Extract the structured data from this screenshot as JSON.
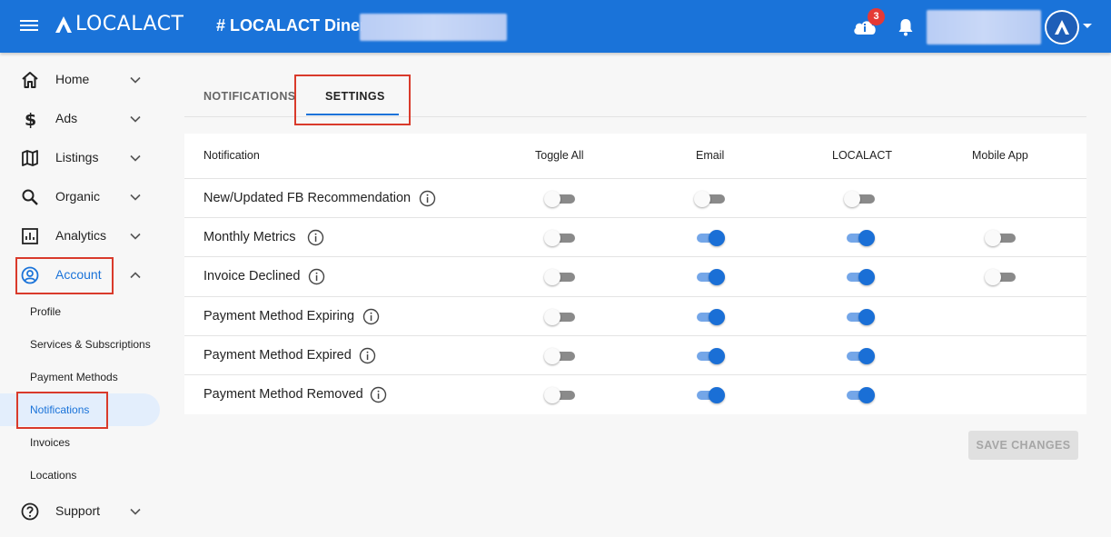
{
  "header": {
    "logo_text": "LOCALACT",
    "business_name": "# LOCALACT Diner",
    "notification_count": "3",
    "icons": [
      "menu-icon",
      "cloud-info-icon",
      "bell-icon",
      "localact-avatar-icon",
      "caret-down-icon"
    ],
    "color": "#1a73d9"
  },
  "sidebar": {
    "items": [
      {
        "label": "Home",
        "icon": "home-icon"
      },
      {
        "label": "Ads",
        "icon": "dollar-icon"
      },
      {
        "label": "Listings",
        "icon": "map-icon"
      },
      {
        "label": "Organic",
        "icon": "search-icon"
      },
      {
        "label": "Analytics",
        "icon": "analytics-icon"
      },
      {
        "label": "Account",
        "icon": "account-circle-icon",
        "expanded": true
      },
      {
        "label": "Support",
        "icon": "help-icon"
      }
    ],
    "account_subitems": [
      {
        "label": "Profile"
      },
      {
        "label": "Services & Subscriptions"
      },
      {
        "label": "Payment Methods"
      },
      {
        "label": "Notifications",
        "selected": true
      },
      {
        "label": "Invoices"
      },
      {
        "label": "Locations"
      }
    ]
  },
  "tabs": [
    {
      "label": "NOTIFICATIONS",
      "active": false
    },
    {
      "label": "SETTINGS",
      "active": true
    }
  ],
  "table": {
    "columns": [
      "Notification",
      "Toggle All",
      "Email",
      "LOCALACT",
      "Mobile App"
    ],
    "rows": [
      {
        "label": "New/Updated FB Recommendation",
        "toggle_all": false,
        "email": false,
        "localact": false,
        "mobile_app": null
      },
      {
        "label": "Monthly Metrics",
        "toggle_all": false,
        "email": true,
        "localact": true,
        "mobile_app": false
      },
      {
        "label": "Invoice Declined",
        "toggle_all": false,
        "email": true,
        "localact": true,
        "mobile_app": false
      },
      {
        "label": "Payment Method Expiring",
        "toggle_all": false,
        "email": true,
        "localact": true,
        "mobile_app": null
      },
      {
        "label": "Payment Method Expired",
        "toggle_all": false,
        "email": true,
        "localact": true,
        "mobile_app": null
      },
      {
        "label": "Payment Method Removed",
        "toggle_all": false,
        "email": true,
        "localact": true,
        "mobile_app": null
      }
    ]
  },
  "actions": {
    "save_label": "SAVE CHANGES",
    "save_disabled": true
  },
  "colors": {
    "accent": "#1a73d9",
    "highlight_box": "#d93a2b",
    "badge": "#e53935"
  }
}
